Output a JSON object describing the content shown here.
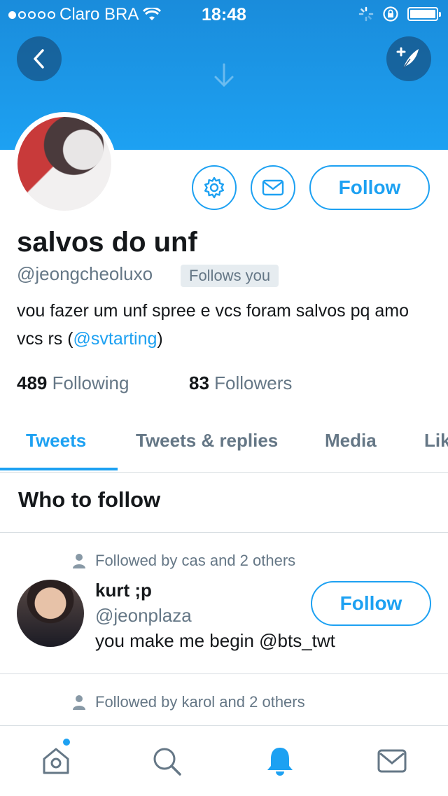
{
  "status_bar": {
    "signal_dots_filled": 1,
    "signal_dots_total": 5,
    "carrier": "Claro BRA",
    "time": "18:48",
    "battery_level": 1.0
  },
  "header": {
    "back_icon": "chevron-left-icon",
    "compose_icon": "compose-tweet-icon",
    "background_color": "#1da1f2"
  },
  "profile": {
    "name": "salvos do unf",
    "handle": "@jeongcheoluxo",
    "follows_you_badge": "Follows you",
    "bio_text": "vou fazer um unf spree e vcs foram salvos pq amo vcs rs (",
    "bio_mention": "@svtarting",
    "bio_end": ")",
    "follow_label": "Follow",
    "following_count": "489",
    "following_label": "Following",
    "followers_count": "83",
    "followers_label": "Followers"
  },
  "tabs": [
    "Tweets",
    "Tweets & replies",
    "Media",
    "Lik"
  ],
  "active_tab": "Tweets",
  "who_to_follow": {
    "title": "Who to follow",
    "cards": [
      {
        "meta": "Followed by cas and 2 others",
        "name": "kurt ;p",
        "handle": "@jeonplaza",
        "bio": "you make me begin @bts_twt",
        "follow_label": "Follow"
      },
      {
        "meta": "Followed by karol and 2 others"
      }
    ]
  },
  "tab_bar": {
    "items": [
      "home-icon",
      "search-icon",
      "notifications-icon",
      "messages-icon"
    ],
    "active": "notifications-icon",
    "accent": "#1da1f2",
    "inactive": "#657786"
  }
}
